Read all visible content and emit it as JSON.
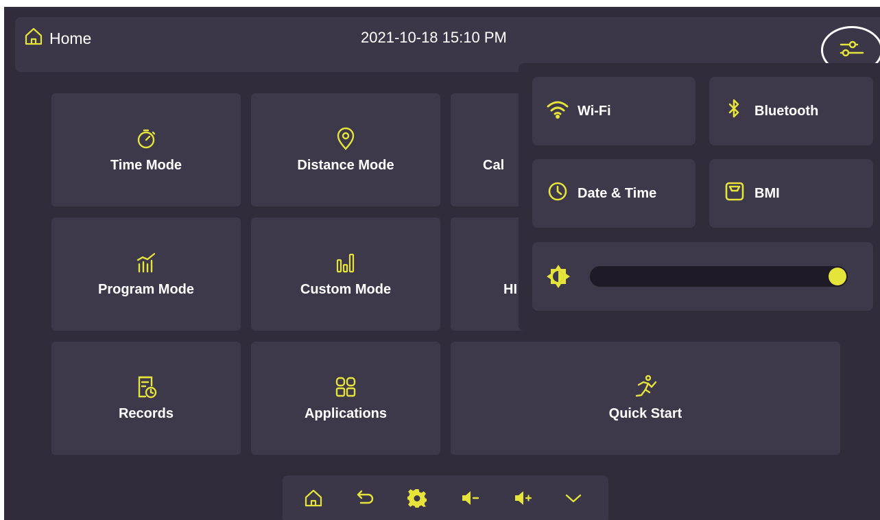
{
  "header": {
    "home_label": "Home",
    "datetime": "2021-10-18 15:10 PM"
  },
  "tiles": [
    {
      "label": "Time Mode",
      "icon": "stopwatch-icon"
    },
    {
      "label": "Distance Mode",
      "icon": "location-pin-icon"
    },
    {
      "label": "Cal",
      "icon": "calorie-icon"
    },
    {
      "label": "Program Mode",
      "icon": "chart-trend-icon"
    },
    {
      "label": "Custom Mode",
      "icon": "bars-icon"
    },
    {
      "label": "HI",
      "icon": "hiit-icon"
    },
    {
      "label": "Records",
      "icon": "records-icon"
    },
    {
      "label": "Applications",
      "icon": "apps-grid-icon"
    },
    {
      "label": "Quick Start",
      "icon": "runner-icon"
    }
  ],
  "quick_settings": {
    "wifi": "Wi-Fi",
    "bluetooth": "Bluetooth",
    "date_time": "Date & Time",
    "bmi": "BMI",
    "brightness": 1.0
  },
  "navbar": [
    "home-icon",
    "back-icon",
    "settings-gear-icon",
    "volume-down-icon",
    "volume-up-icon",
    "collapse-chevron-icon"
  ],
  "colors": {
    "background": "#302c3b",
    "tile": "#3d394a",
    "accent": "#e6e33a",
    "text": "#ffffff"
  }
}
